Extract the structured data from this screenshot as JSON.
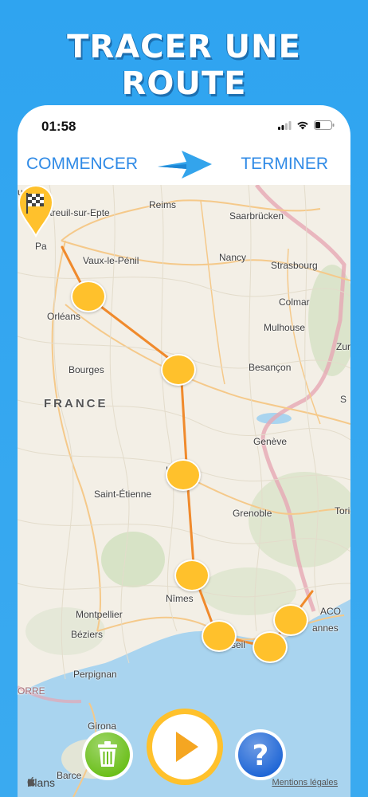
{
  "headline": "TRACER UNE ROUTE",
  "status": {
    "time": "01:58"
  },
  "toolbar": {
    "start_label": "COMMENCER",
    "end_label": "TERMINER"
  },
  "colors": {
    "accent": "#2f8ae6",
    "route": "#f08a2c",
    "stop": "#ffc12c",
    "trash": "#6bbf1a",
    "play": "#ffc12c",
    "help": "#1f66d6"
  },
  "map": {
    "labels": {
      "rouen": "uen",
      "montreuil": "Montreuil-sur-Epte",
      "reims": "Reims",
      "saarbrucken": "Saarbrücken",
      "paris": "Pa",
      "vaux": "Vaux-le-Pénil",
      "nancy": "Nancy",
      "strasbourg": "Strasbourg",
      "orleans": "Orléans",
      "colmar": "Colmar",
      "mulhouse": "Mulhouse",
      "zurich": "Zur",
      "bourges": "Bourges",
      "besancon": "Besançon",
      "france": "FRANCE",
      "geneve": "Genève",
      "lyon": "L",
      "saintetienne": "Saint-Étienne",
      "grenoble": "Grenoble",
      "torino": "Tori",
      "nimes": "Nîmes",
      "montpellier": "Montpellier",
      "beziers": "Béziers",
      "marseille": "seil",
      "monaco": "ACO",
      "cannes": "annes",
      "perpignan": "Perpignan",
      "andorra": "ORRE",
      "girona": "Girona",
      "barcelona": "Barce",
      "sui": "S"
    },
    "attribution": "Plans",
    "legal": "Mentions légales"
  },
  "icons": {
    "start": "group-icon",
    "end": "checkered-flag-icon",
    "trash": "trash-icon",
    "play": "play-icon",
    "help": "question-icon"
  },
  "help_symbol": "?"
}
